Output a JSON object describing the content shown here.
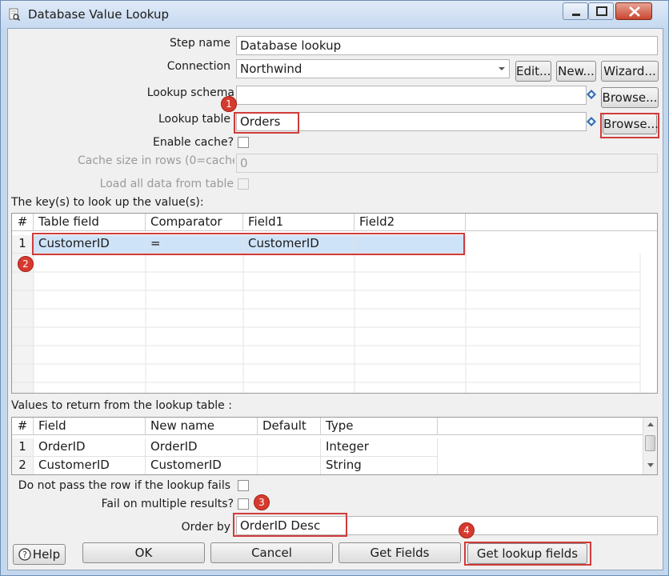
{
  "window": {
    "title": "Database Value Lookup"
  },
  "form": {
    "step_name_label": "Step name",
    "step_name_value": "Database lookup",
    "connection_label": "Connection",
    "connection_value": "Northwind",
    "edit_button": "Edit...",
    "new_button": "New...",
    "wizard_button": "Wizard...",
    "lookup_schema_label": "Lookup schema",
    "lookup_schema_value": "",
    "browse_button": "Browse...",
    "lookup_table_label": "Lookup table",
    "lookup_table_value": "Orders",
    "enable_cache_label": "Enable cache?",
    "cache_size_label": "Cache size in rows (0=cache",
    "cache_size_value": "0",
    "load_all_label": "Load all data from table"
  },
  "keys": {
    "section_label": "The key(s) to look up the value(s):",
    "columns": [
      "#",
      "Table field",
      "Comparator",
      "Field1",
      "Field2"
    ],
    "rows": [
      {
        "num": "1",
        "table_field": "CustomerID",
        "comparator": "=",
        "field1": "CustomerID",
        "field2": ""
      }
    ]
  },
  "values": {
    "section_label": "Values to return from the lookup table :",
    "columns": [
      "#",
      "Field",
      "New name",
      "Default",
      "Type"
    ],
    "rows": [
      {
        "num": "1",
        "field": "OrderID",
        "new_name": "OrderID",
        "default": "",
        "type": "Integer"
      },
      {
        "num": "2",
        "field": "CustomerID",
        "new_name": "CustomerID",
        "default": "",
        "type": "String"
      }
    ]
  },
  "options": {
    "no_pass_label": "Do not pass the row if the lookup fails",
    "fail_multiple_label": "Fail on multiple results?",
    "order_by_label": "Order by",
    "order_by_value": "OrderID Desc"
  },
  "buttons": {
    "help": "Help",
    "ok": "OK",
    "cancel": "Cancel",
    "get_fields": "Get Fields",
    "get_lookup_fields": "Get lookup fields"
  },
  "annotations": [
    "1",
    "2",
    "3",
    "4"
  ]
}
